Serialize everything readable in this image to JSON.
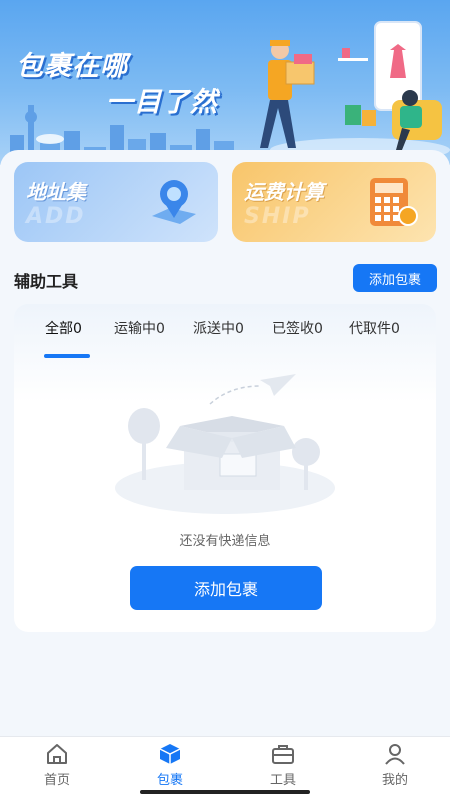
{
  "banner": {
    "title_line1": "包裹在哪",
    "title_line2": "一目了然",
    "accent": "#5aa6f0"
  },
  "features": [
    {
      "title": "地址集",
      "watermark": "ADD",
      "icon": "map-pin-icon"
    },
    {
      "title": "运费计算",
      "watermark": "SHIP",
      "icon": "calculator-icon"
    }
  ],
  "tools": {
    "title": "辅助工具",
    "add_label": "添加包裹"
  },
  "tabs": [
    {
      "label": "全部0",
      "active": true
    },
    {
      "label": "运输中0",
      "active": false
    },
    {
      "label": "派送中0",
      "active": false
    },
    {
      "label": "已签收0",
      "active": false
    },
    {
      "label": "代取件0",
      "active": false
    }
  ],
  "empty": {
    "message": "还没有快递信息",
    "button_label": "添加包裹",
    "icon": "empty-box-icon"
  },
  "nav": [
    {
      "label": "首页",
      "icon": "home-icon",
      "active": false
    },
    {
      "label": "包裹",
      "icon": "package-icon",
      "active": true
    },
    {
      "label": "工具",
      "icon": "toolbox-icon",
      "active": false
    },
    {
      "label": "我的",
      "icon": "user-icon",
      "active": false
    }
  ],
  "colors": {
    "primary": "#1677f5",
    "address_card": "#9cc6f6",
    "fee_card": "#f8c56a"
  }
}
